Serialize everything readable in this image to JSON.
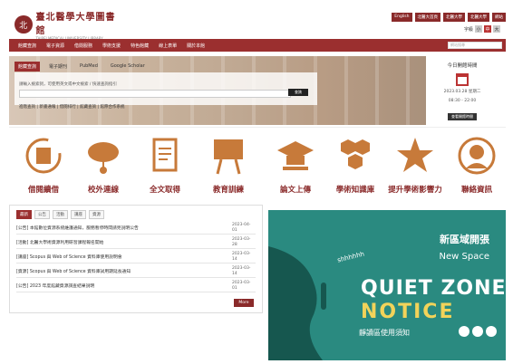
{
  "header": {
    "logo_mark": "北",
    "logo_zh": "臺北醫學大學圖書館",
    "logo_en": "TAIPEI MEDICAL UNIVERSITY LIBRARY",
    "top_links": [
      "English",
      "北醫大首頁",
      "北醫大學",
      "北醫大學",
      "網站"
    ],
    "font_label": "字級",
    "font_sizes": [
      "小",
      "中",
      "大"
    ]
  },
  "nav": {
    "items": [
      "館藏查詢",
      "電子資源",
      "借閱服務",
      "學術支援",
      "特色館藏",
      "線上表單",
      "關於本館"
    ],
    "search_placeholder": "網站搜尋"
  },
  "search": {
    "tabs": [
      "館藏查詢",
      "電子期刊",
      "PubMed",
      "Google Scholar"
    ],
    "active_tab": 0,
    "hint": "請輸入檢索詞，可使用英文或中文檢索 / 快速查詢指引",
    "input_value": "",
    "button": "查詢",
    "links": "進階查詢 | 新書通報 | 借閱排行 | 館藏查詢 | 館際合作系統"
  },
  "hours": {
    "title": "今日開館時間",
    "date": "2023.03.28 星期二",
    "time": "08:30 - 22:00",
    "button": "查看開館時間"
  },
  "services": [
    {
      "label": "借閱續借",
      "icon": "book-renew-icon"
    },
    {
      "label": "校外連線",
      "icon": "cloud-connect-icon"
    },
    {
      "label": "全文取得",
      "icon": "document-icon"
    },
    {
      "label": "教育訓練",
      "icon": "training-board-icon"
    },
    {
      "label": "論文上傳",
      "icon": "graduation-cap-icon"
    },
    {
      "label": "學術知識庫",
      "icon": "hexagon-cluster-icon"
    },
    {
      "label": "提升學術影響力",
      "icon": "star-icon"
    },
    {
      "label": "聯絡資訊",
      "icon": "contact-person-icon"
    }
  ],
  "news": {
    "tabs": [
      "最新",
      "公告",
      "活動",
      "講座",
      "資源"
    ],
    "active_tab": 0,
    "items": [
      {
        "title": "[公告] 本館數位資源系統維護通知，服務暫停時間請見說明公告",
        "date": "2023-04-01"
      },
      {
        "title": "[活動] 北醫大學術資源利用研習課程報名開始",
        "date": "2023-03-28"
      },
      {
        "title": "[講座] Scopus 與 Web of Science 資料庫使用說明會",
        "date": "2023-03-14"
      },
      {
        "title": "[資源] Scopus 與 Web of Science 資料庫試用期延長通知",
        "date": "2023-03-14"
      },
      {
        "title": "[公告] 2023 年度館藏資源調查結果說明",
        "date": "2023-03-01"
      }
    ],
    "more": "More"
  },
  "banner": {
    "zh_title": "新區域開張",
    "en_title": "New Space",
    "shh": "shhhhhh",
    "quiet": "QUIET ZONE",
    "notice": "NOTICE",
    "sub": "靜讀區使用須知"
  },
  "colors": {
    "brand": "#8a2a2a",
    "nav": "#9b2f2f",
    "banner": "#2a8a80",
    "notice": "#f2d35a"
  }
}
